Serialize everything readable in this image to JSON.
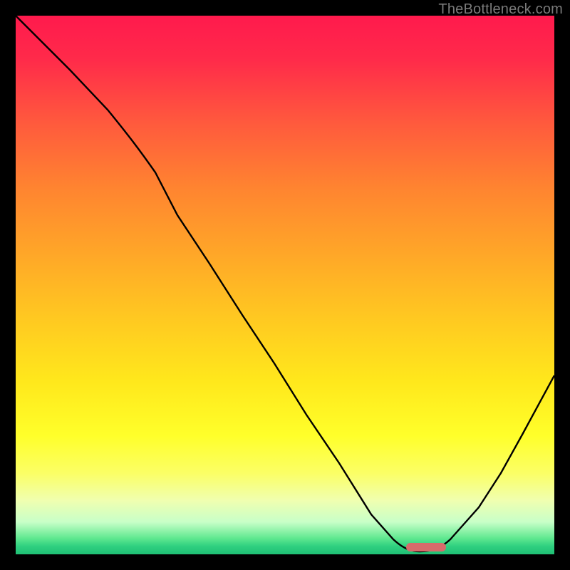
{
  "watermark": "TheBottleneck.com",
  "chart_data": {
    "type": "line",
    "title": "",
    "xlabel": "",
    "ylabel": "",
    "xlim": [
      0,
      100
    ],
    "ylim": [
      0,
      100
    ],
    "series": [
      {
        "name": "curve",
        "x": [
          0,
          10,
          17,
          24,
          30,
          36,
          42,
          48,
          54,
          60,
          66,
          72,
          75,
          78,
          82,
          86,
          90,
          94,
          100
        ],
        "y": [
          100,
          90,
          83,
          75,
          67,
          58,
          50,
          41,
          33,
          24,
          16,
          7,
          3,
          1,
          1,
          4,
          10,
          18,
          33
        ]
      }
    ],
    "gradient_colors": [
      "#ff1a4d",
      "#ffa628",
      "#ffff2a",
      "#60e890",
      "#1fc075"
    ],
    "marker": {
      "x_start": 72,
      "x_end": 80,
      "y": 2,
      "color": "#d86b6b"
    }
  }
}
